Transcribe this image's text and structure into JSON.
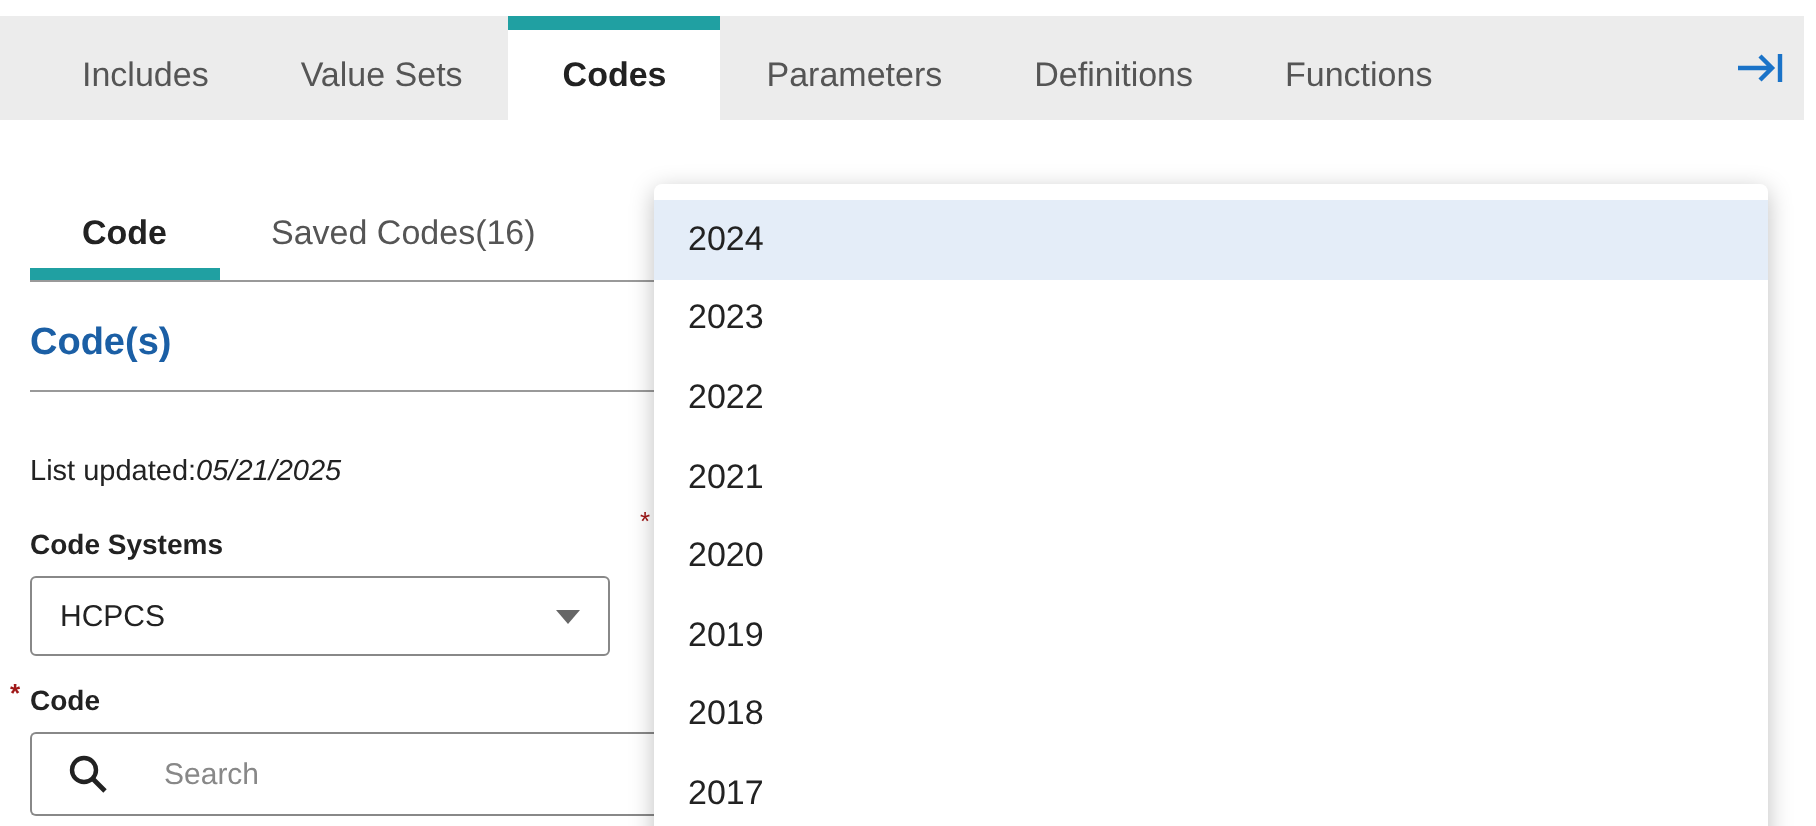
{
  "tabs": [
    {
      "label": "Includes",
      "selected": false
    },
    {
      "label": "Value Sets",
      "selected": false
    },
    {
      "label": "Codes",
      "selected": true
    },
    {
      "label": "Parameters",
      "selected": false
    },
    {
      "label": "Definitions",
      "selected": false
    },
    {
      "label": "Functions",
      "selected": false
    }
  ],
  "sub_tabs": [
    {
      "label": "Code",
      "selected": true
    },
    {
      "label": "Saved Codes(16)",
      "selected": false
    }
  ],
  "section_title": "Code(s)",
  "list_updated": {
    "label": "List updated:",
    "date": "05/21/2025"
  },
  "code_systems": {
    "label": "Code Systems",
    "value": "HCPCS"
  },
  "hidden_field": {
    "required_mark": "*"
  },
  "code": {
    "label": "Code",
    "required_mark": "*",
    "placeholder": "Search"
  },
  "dropdown": {
    "options": [
      {
        "label": "2024",
        "selected": true
      },
      {
        "label": "2023",
        "selected": false
      },
      {
        "label": "2022",
        "selected": false
      },
      {
        "label": "2021",
        "selected": false
      },
      {
        "label": "2020",
        "selected": false
      },
      {
        "label": "2019",
        "selected": false
      },
      {
        "label": "2018",
        "selected": false
      },
      {
        "label": "2017",
        "selected": false
      }
    ]
  }
}
